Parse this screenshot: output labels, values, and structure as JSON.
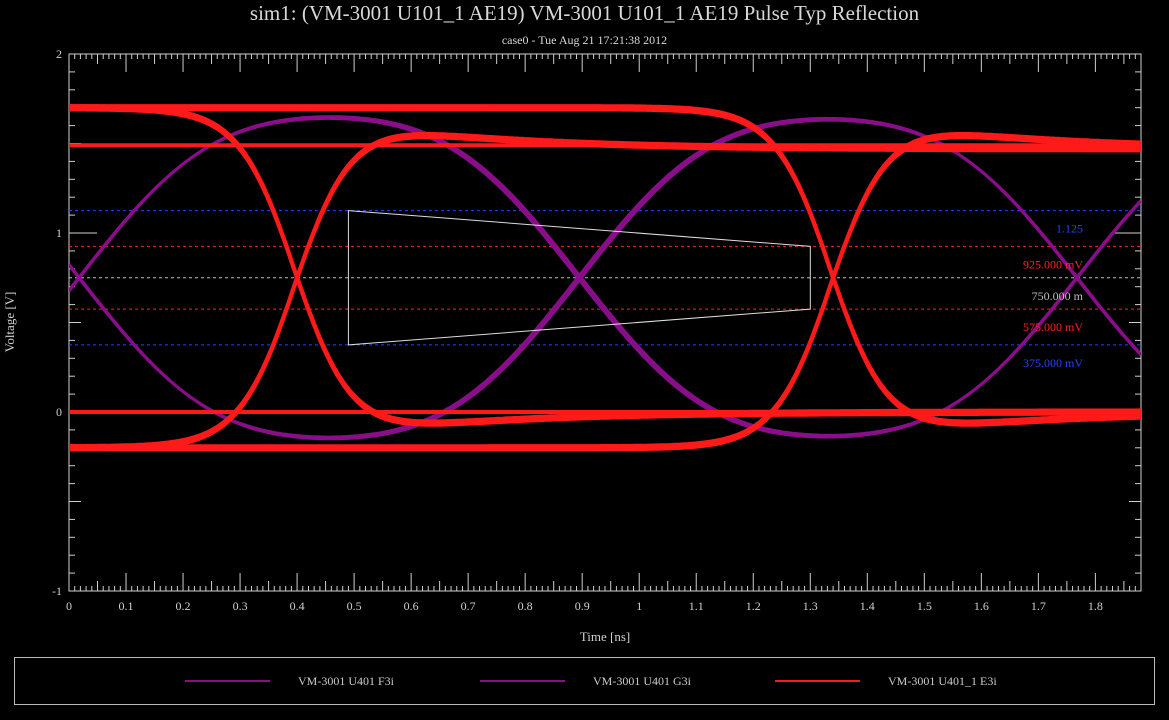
{
  "chart_data": {
    "type": "line",
    "title": "sim1: (VM-3001 U101_1 AE19) VM-3001 U101_1 AE19 Pulse Typ Reflection",
    "subtitle": "case0 - Tue Aug 21 17:21:38 2012",
    "xlabel": "Time [ns]",
    "ylabel": "Voltage [V]",
    "xlim": [
      0,
      1.88
    ],
    "ylim": [
      -1,
      2
    ],
    "x_ticks": [
      "0",
      "0.1",
      "0.2",
      "0.3",
      "0.4",
      "0.5",
      "0.6",
      "0.7",
      "0.8",
      "0.9",
      "1",
      "1.1",
      "1.2",
      "1.3",
      "1.4",
      "1.5",
      "1.6",
      "1.7",
      "1.8"
    ],
    "y_ticks": [
      "-1",
      "0",
      "1",
      "2"
    ],
    "unit_interval_ns": 0.875,
    "series": [
      {
        "name": "VM-3001 U401 F3i",
        "color": "#8a0e8a",
        "high": 1.72,
        "low": -0.21,
        "mid": 0.75,
        "crossings_ns": [
          0.017,
          0.891,
          1.767
        ]
      },
      {
        "name": "VM-3001 U401 G3i",
        "color": "#8a0e8a",
        "high": 1.72,
        "low": -0.21,
        "mid": 0.75,
        "crossings_ns": [
          0.017,
          0.891,
          1.767
        ]
      },
      {
        "name": "VM-3001 U401_1 E3i",
        "color": "#ff1a1a",
        "high_overshoot": 1.72,
        "high_settle": 1.49,
        "low_overshoot": -0.2,
        "low_settle": 0.0,
        "crossings_ns": [
          0.4,
          1.34
        ]
      }
    ],
    "reference_lines": [
      {
        "value": 1.125,
        "label": "1.125",
        "color": "#2244ff"
      },
      {
        "value": 0.925,
        "label": "925.000 mV",
        "color": "#ff2020"
      },
      {
        "value": 0.75,
        "label": "750.000 m",
        "color": "#bdbdbd"
      },
      {
        "value": 0.575,
        "label": "575.000 mV",
        "color": "#ff2020"
      },
      {
        "value": 0.375,
        "label": "375.000 mV",
        "color": "#2244ff"
      }
    ],
    "eye_mask": {
      "color": "#dddddd",
      "points": [
        [
          0.49,
          1.125
        ],
        [
          1.3,
          0.925
        ],
        [
          1.3,
          0.575
        ],
        [
          0.49,
          0.375
        ]
      ]
    },
    "legend": {
      "position": "bottom"
    },
    "grid": false
  }
}
